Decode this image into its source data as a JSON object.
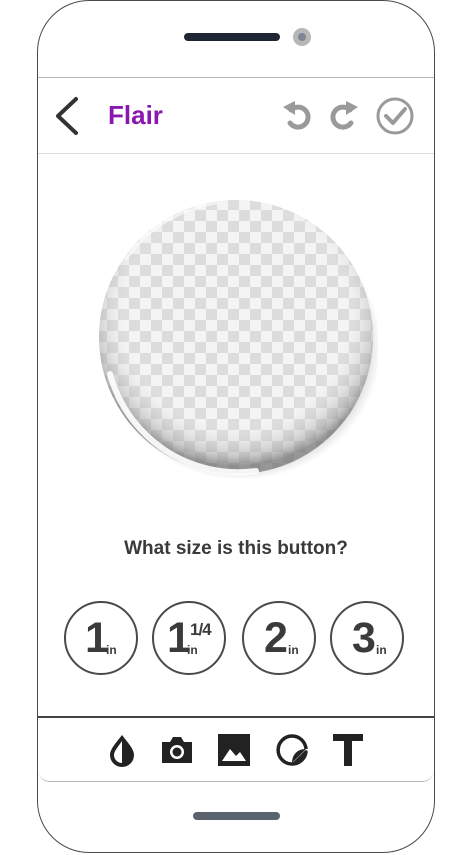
{
  "header": {
    "back_icon": "chevron-left-icon",
    "title": "Flair",
    "undo_icon": "undo-icon",
    "redo_icon": "redo-icon",
    "confirm_icon": "check-circle-icon",
    "title_color": "#8a18b0"
  },
  "canvas": {
    "preview": "button-badge-transparent"
  },
  "question": "What size is this button?",
  "sizes": [
    {
      "value": "1",
      "fraction": "",
      "unit": "in"
    },
    {
      "value": "1",
      "fraction": "1/4",
      "unit": "in"
    },
    {
      "value": "2",
      "fraction": "",
      "unit": "in"
    },
    {
      "value": "3",
      "fraction": "",
      "unit": "in"
    }
  ],
  "toolbar": {
    "items": [
      "color-drop-icon",
      "camera-icon",
      "image-icon",
      "sticker-icon",
      "text-icon"
    ]
  }
}
